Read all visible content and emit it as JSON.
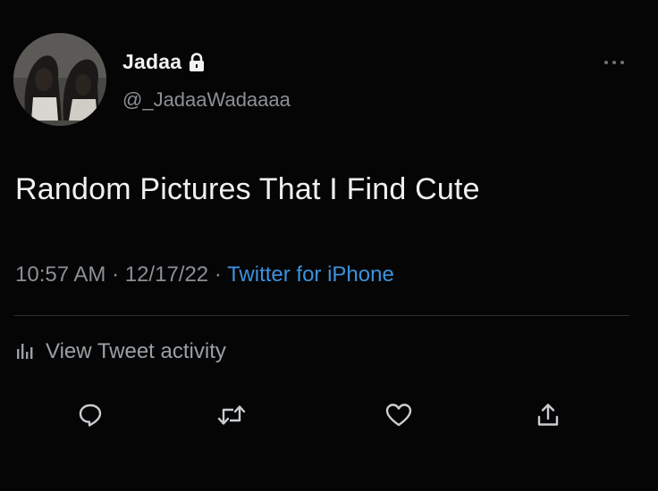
{
  "tweet": {
    "display_name": "Jadaa",
    "handle": "@_JadaaWadaaaa",
    "text": "Random Pictures That I Find Cute",
    "time": "10:57 AM",
    "separator1": " · ",
    "date": "12/17/22",
    "separator2": " · ",
    "source": "Twitter for iPhone",
    "activity_label": "View Tweet activity"
  },
  "icons": {
    "lock": "lock-icon",
    "more": "more-icon",
    "activity": "bar-chart-icon",
    "reply": "reply-icon",
    "retweet": "retweet-icon",
    "like": "heart-icon",
    "share": "share-icon"
  },
  "colors": {
    "background": "#050505",
    "text": "#f0f0f0",
    "secondary": "#8b9096",
    "link": "#3b92dc",
    "divider": "#2b2e31"
  }
}
